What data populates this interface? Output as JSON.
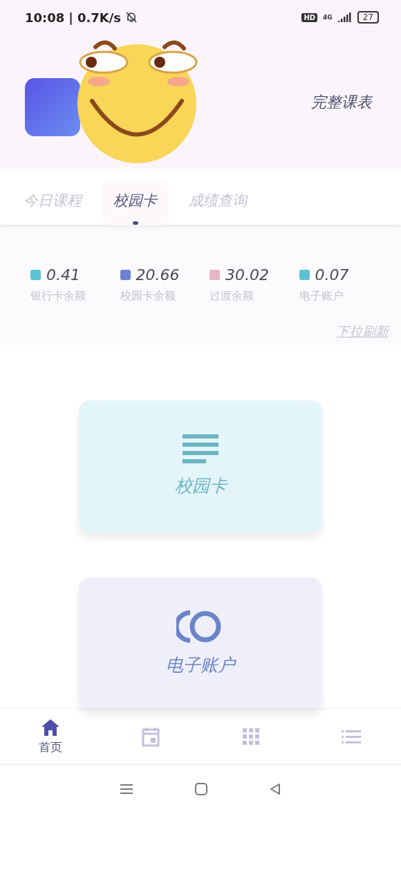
{
  "status_bar": {
    "time": "10:08",
    "separator": "|",
    "speed": "0.7K/s",
    "hd": "HD",
    "network": "4G",
    "battery": "27"
  },
  "header": {
    "schedule_link": "完整课表"
  },
  "tabs": [
    {
      "label": "今日课程",
      "selected": false
    },
    {
      "label": "校园卡",
      "selected": true
    },
    {
      "label": "成绩查询",
      "selected": false
    }
  ],
  "balances": [
    {
      "value": "0.41",
      "label": "银行卡余额",
      "color": "#5bc3d1"
    },
    {
      "value": "20.66",
      "label": "校园卡余额",
      "color": "#6b82d8"
    },
    {
      "value": "30.02",
      "label": "过渡余额",
      "color": "#e8b4c8"
    },
    {
      "value": "0.07",
      "label": "电子账户",
      "color": "#5bc3d1"
    }
  ],
  "refresh_hint": "下拉刷新",
  "cards": [
    {
      "kind": "card",
      "title": "校园卡"
    },
    {
      "kind": "account",
      "title": "电子账户"
    }
  ],
  "bottom_nav": [
    {
      "kind": "home",
      "label": "首页",
      "selected": true
    },
    {
      "kind": "calendar",
      "selected": false
    },
    {
      "kind": "grid",
      "selected": false
    },
    {
      "kind": "list",
      "selected": false
    }
  ]
}
